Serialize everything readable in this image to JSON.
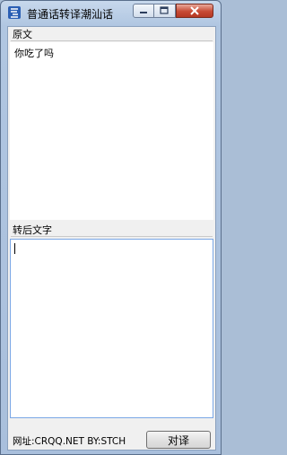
{
  "window": {
    "title": "普通话转译潮汕话",
    "icon": "app-logo-icon"
  },
  "controls": {
    "minimize_icon": "minimize-icon",
    "maximize_icon": "maximize-icon",
    "close_icon": "close-icon"
  },
  "source": {
    "label": "原文",
    "text": "你吃了吗"
  },
  "result": {
    "label": "转后文字",
    "text": ""
  },
  "footer": {
    "url_text": "网址:CRQQ.NET BY:STCH",
    "translate_label": "对译"
  },
  "colors": {
    "frame": "#aabed6",
    "close_button": "#c74a34",
    "focus_border": "#7aa7e6"
  }
}
